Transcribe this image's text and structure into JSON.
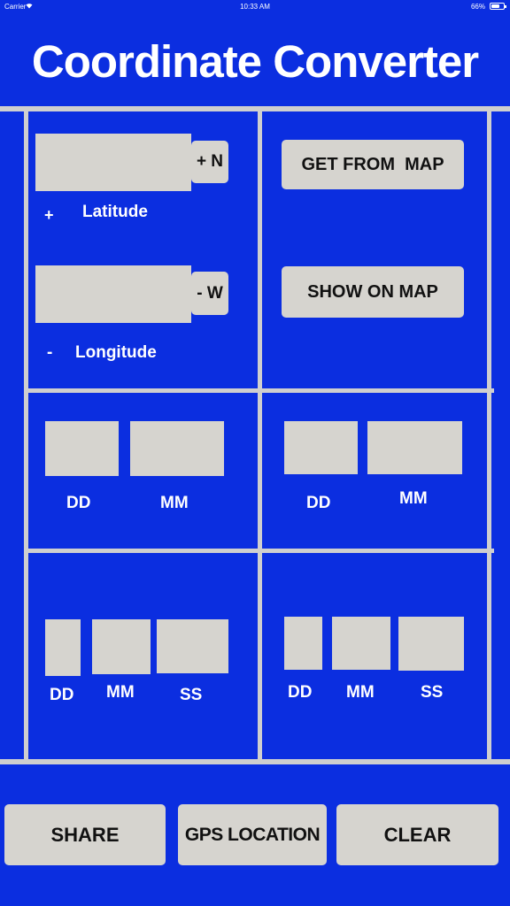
{
  "status_bar": {
    "carrier": "Carrier",
    "time": "10:33 AM",
    "battery": "66%"
  },
  "title": "Coordinate Converter",
  "decimal_panel": {
    "latitude_sign": "+",
    "latitude_label": "Latitude",
    "latitude_hemisphere_button": "+ N",
    "longitude_sign": "-",
    "longitude_label": "Longitude",
    "longitude_hemisphere_button": "- W"
  },
  "map_panel": {
    "get_from_map": "GET FROM  MAP",
    "show_on_map": "SHOW ON MAP"
  },
  "dm_left": {
    "dd": "DD",
    "mm": "MM"
  },
  "dm_right": {
    "dd": "DD",
    "mm": "MM"
  },
  "dms_left": {
    "dd": "DD",
    "mm": "MM",
    "ss": "SS"
  },
  "dms_right": {
    "dd": "DD",
    "mm": "MM",
    "ss": "SS"
  },
  "bottom_bar": {
    "share": "SHARE",
    "gps_location": "GPS LOCATION",
    "clear": "CLEAR"
  },
  "colors": {
    "background": "#0b2ee0",
    "field": "#d6d4cf",
    "grid_line": "#cfcfcf"
  }
}
